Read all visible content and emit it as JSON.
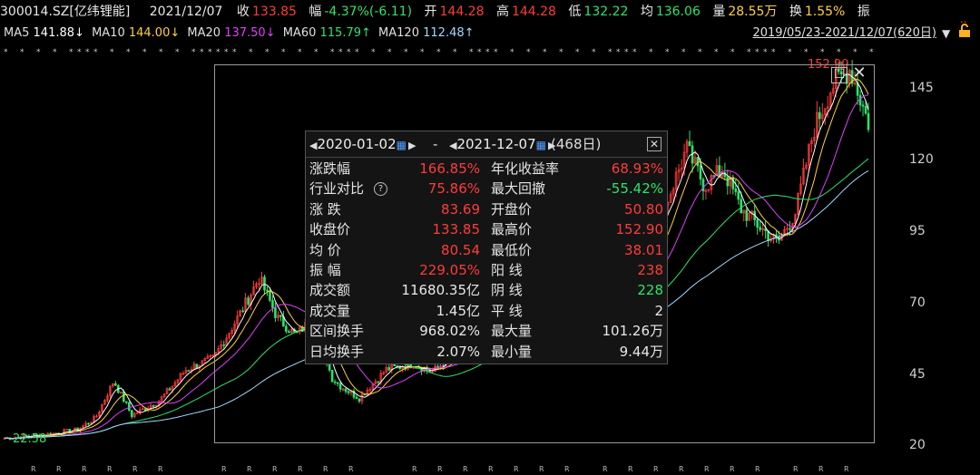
{
  "header": {
    "code": "300014.SZ[亿纬锂能]",
    "date": "2021/12/07",
    "close_label": "收",
    "close_value": "133.85",
    "change_label": "幅",
    "change_value": "-4.37%(-6.11)",
    "open_label": "开",
    "open_value": "144.28",
    "high_label": "高",
    "high_value": "144.28",
    "low_label": "低",
    "low_value": "132.22",
    "avg_label": "均",
    "avg_value": "136.06",
    "vol_label": "量",
    "vol_value": "28.55万",
    "turn_label": "换",
    "turn_value": "1.55%",
    "amp_label": "振"
  },
  "ma_bar": {
    "items": [
      {
        "label": "MA5",
        "value": "141.88↓"
      },
      {
        "label": "MA10",
        "value": "144.00↓"
      },
      {
        "label": "MA20",
        "value": "137.50↓"
      },
      {
        "label": "MA60",
        "value": "115.79↑"
      },
      {
        "label": "MA120",
        "value": "112.48↑"
      }
    ],
    "range": "2019/05/23-2021/12/07(620日)",
    "dropdown_icon": "triangle-down-icon",
    "lock_icon": "lock-icon"
  },
  "colors": {
    "up": "#ff3b3b",
    "down": "#2ee36a",
    "ma5": "#ffffff",
    "ma10": "#ffd23b",
    "ma20": "#e040fb",
    "ma60": "#2ee36a",
    "ma120": "#9fd8ff"
  },
  "chart": {
    "y_ticks": [
      "145",
      "120",
      "95",
      "70",
      "45",
      "20"
    ],
    "y_values": [
      145,
      120,
      95,
      70,
      45,
      20
    ],
    "peak_label": "152.90",
    "low_label": "22.58"
  },
  "chart_data": {
    "type": "candlestick",
    "ylim": [
      18,
      155
    ],
    "y_ticks": [
      145,
      120,
      95,
      70,
      45,
      20
    ],
    "x_range": "2019/05/23-2021/12/07",
    "close_path": [
      [
        0,
        24
      ],
      [
        0.04,
        25
      ],
      [
        0.08,
        27
      ],
      [
        0.1,
        31
      ],
      [
        0.12,
        44
      ],
      [
        0.14,
        32
      ],
      [
        0.17,
        37
      ],
      [
        0.2,
        48
      ],
      [
        0.23,
        52
      ],
      [
        0.26,
        68
      ],
      [
        0.28,
        80
      ],
      [
        0.3,
        66
      ],
      [
        0.32,
        60
      ],
      [
        0.34,
        66
      ],
      [
        0.36,
        45
      ],
      [
        0.37,
        42
      ],
      [
        0.39,
        38
      ],
      [
        0.42,
        48
      ],
      [
        0.45,
        50
      ],
      [
        0.47,
        47
      ],
      [
        0.5,
        55
      ],
      [
        0.53,
        60
      ],
      [
        0.56,
        62
      ],
      [
        0.6,
        66
      ],
      [
        0.64,
        70
      ],
      [
        0.68,
        75
      ],
      [
        0.71,
        90
      ],
      [
        0.73,
        108
      ],
      [
        0.75,
        125
      ],
      [
        0.77,
        112
      ],
      [
        0.79,
        118
      ],
      [
        0.81,
        104
      ],
      [
        0.83,
        98
      ],
      [
        0.85,
        92
      ],
      [
        0.87,
        103
      ],
      [
        0.89,
        132
      ],
      [
        0.91,
        147
      ],
      [
        0.93,
        153
      ],
      [
        0.95,
        134
      ]
    ],
    "annotations": {
      "max": 152.9,
      "min": 22.58
    }
  },
  "selection_panel": {
    "start_date": "2020-01-02",
    "end_date": "2021-12-07",
    "sep": "-",
    "days": "(468日)",
    "rows": [
      {
        "l1": "涨跌幅",
        "v1": "166.85%",
        "c1": "r",
        "l2": "年化收益率",
        "v2": "68.93%",
        "c2": "r"
      },
      {
        "l1": "行业对比",
        "v1": "75.86%",
        "c1": "r",
        "l2": "最大回撤",
        "v2": "-55.42%",
        "c2": "g",
        "help": "?"
      },
      {
        "l1": "涨  跌",
        "v1": "83.69",
        "c1": "r",
        "l2": "开盘价",
        "v2": "50.80",
        "c2": "r"
      },
      {
        "l1": "收盘价",
        "v1": "133.85",
        "c1": "r",
        "l2": "最高价",
        "v2": "152.90",
        "c2": "r"
      },
      {
        "l1": "均  价",
        "v1": "80.54",
        "c1": "r",
        "l2": "最低价",
        "v2": "38.01",
        "c2": "r"
      },
      {
        "l1": "振  幅",
        "v1": "229.05%",
        "c1": "r",
        "l2": "阳  线",
        "v2": "238",
        "c2": "r"
      },
      {
        "l1": "成交额",
        "v1": "11680.35亿",
        "c1": "wv",
        "l2": "阴  线",
        "v2": "228",
        "c2": "g"
      },
      {
        "l1": "成交量",
        "v1": "1.45亿",
        "c1": "wv",
        "l2": "平  线",
        "v2": "2",
        "c2": "wv"
      },
      {
        "l1": "区间换手",
        "v1": "968.02%",
        "c1": "wv",
        "l2": "最大量",
        "v2": "101.26万",
        "c2": "wv"
      },
      {
        "l1": "日均换手",
        "v1": "2.07%",
        "c1": "wv",
        "l2": "最小量",
        "v2": "9.44万",
        "c2": "wv"
      }
    ]
  }
}
